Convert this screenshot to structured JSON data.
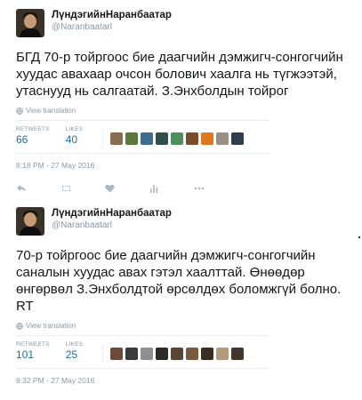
{
  "tweets": [
    {
      "fullname": "ЛүндэгийнНаранбаатар",
      "username": "@Naranbaatarl",
      "text": "БГД 70-р тойргоос бие даагчийн дэмжигч-сонгогчийн хуудас авахаар очсон болович хаалга нь түгжээтэй, утаснууд нь салгаатай. З.Энхболдын тойрог",
      "translate_label": "View translation",
      "retweets_label": "RETWEETS",
      "retweets_value": "66",
      "likes_label": "LIKES",
      "likes_value": "40",
      "timestamp": "8:18 PM - 27 May 2016",
      "liker_colors": [
        "#8a6d4f",
        "#5b7a3a",
        "#3d6e8f",
        "#2f4f4f",
        "#4a8f5c",
        "#7b4c2a",
        "#e0781f",
        "#9a8f86",
        "#2c3e50"
      ]
    },
    {
      "fullname": "ЛүндэгийнНаранбаатар",
      "username": "@Naranbaatarl",
      "text": "70-р тойргоос бие даагчийн дэмжигч-сонгогчийн саналын хуудас авах гэтэл хаалттай. Өнөөдөр өнгөрвөл З.Энхболдтой өрсөлдөх боломжгүй болно. RT",
      "translate_label": "View translation",
      "retweets_label": "RETWEETS",
      "retweets_value": "101",
      "likes_label": "LIKES",
      "likes_value": "25",
      "timestamp": "8:32 PM - 27 May 2016",
      "liker_colors": [
        "#6b4a3a",
        "#3b3b3b",
        "#8f8f8f",
        "#2e2a26",
        "#5a4634",
        "#7a5a3d",
        "#3a2e24",
        "#b39a7a",
        "#41372d"
      ]
    }
  ]
}
